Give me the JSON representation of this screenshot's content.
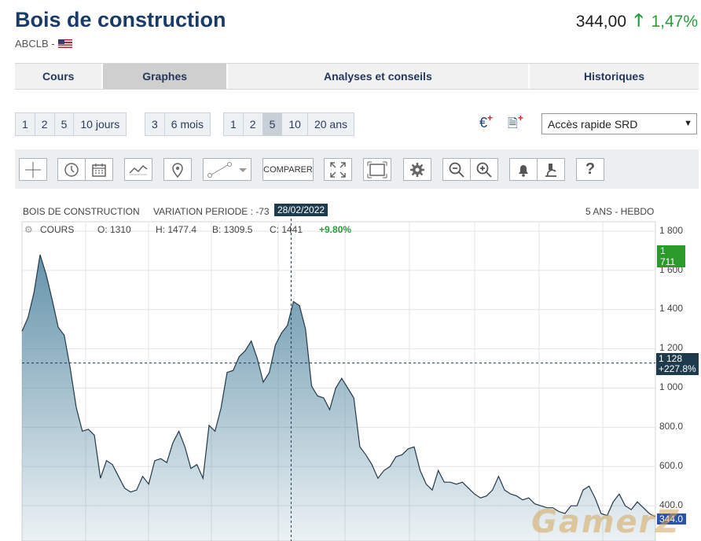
{
  "header": {
    "title": "Bois de construction",
    "ticker": "ABCLB -",
    "price": "344,00",
    "change": "1,47%"
  },
  "tabs": [
    {
      "label": "Cours",
      "active": false
    },
    {
      "label": "Graphes",
      "active": true
    },
    {
      "label": "Analyses et conseils",
      "active": false
    },
    {
      "label": "Historiques",
      "active": false
    }
  ],
  "period_groups": [
    {
      "items": [
        "1",
        "2",
        "5",
        "10 jours"
      ]
    },
    {
      "items": [
        "3",
        "6 mois"
      ]
    },
    {
      "items": [
        "1",
        "2",
        "5",
        "10",
        "20 ans"
      ],
      "active_index": 2
    }
  ],
  "quick_access": {
    "selected": "Accès rapide SRD"
  },
  "toolbar": {
    "compare_label": "COMPARER"
  },
  "chart_header": {
    "name": "BOIS DE CONSTRUCTION",
    "variation": "VARIATION PERIODE : -73",
    "date_badge": "28/02/2022",
    "period": "5 ANS - HEBDO"
  },
  "chart_legend": {
    "series": "COURS",
    "open": "O: 1310",
    "high": "H: 1477.4",
    "low": "B: 1309.5",
    "close": "C: 1441",
    "pct": "+9.80%"
  },
  "price_tags": {
    "top": "1 711",
    "crosshair_value": "1 128",
    "crosshair_pct": "+227.8%",
    "last": "344.0"
  },
  "watermark": "GamerZ",
  "chart_data": {
    "type": "area",
    "ylim": [
      300,
      1800
    ],
    "yticks": [
      "1 800",
      "1 600",
      "1 400",
      "1 200",
      "1 000",
      "800.0",
      "600.0",
      "400.0"
    ],
    "y": [
      1290,
      1360,
      1490,
      1680,
      1580,
      1450,
      1310,
      1270,
      1100,
      900,
      780,
      790,
      760,
      540,
      630,
      610,
      550,
      490,
      470,
      480,
      550,
      510,
      630,
      640,
      620,
      720,
      780,
      700,
      590,
      610,
      540,
      810,
      780,
      900,
      1080,
      1090,
      1160,
      1190,
      1240,
      1150,
      1030,
      1080,
      1220,
      1280,
      1320,
      1441,
      1420,
      1300,
      1010,
      960,
      950,
      890,
      1000,
      1050,
      1000,
      950,
      700,
      660,
      610,
      540,
      580,
      600,
      650,
      660,
      690,
      700,
      580,
      510,
      480,
      580,
      520,
      520,
      510,
      520,
      490,
      460,
      440,
      450,
      480,
      550,
      480,
      460,
      450,
      430,
      440,
      410,
      400,
      390,
      390,
      370,
      360,
      400,
      400,
      480,
      500,
      440,
      360,
      350,
      420,
      460,
      400,
      380,
      420,
      390,
      360,
      344
    ],
    "area_color": "#5d8ea6",
    "line_color": "#23394a"
  }
}
